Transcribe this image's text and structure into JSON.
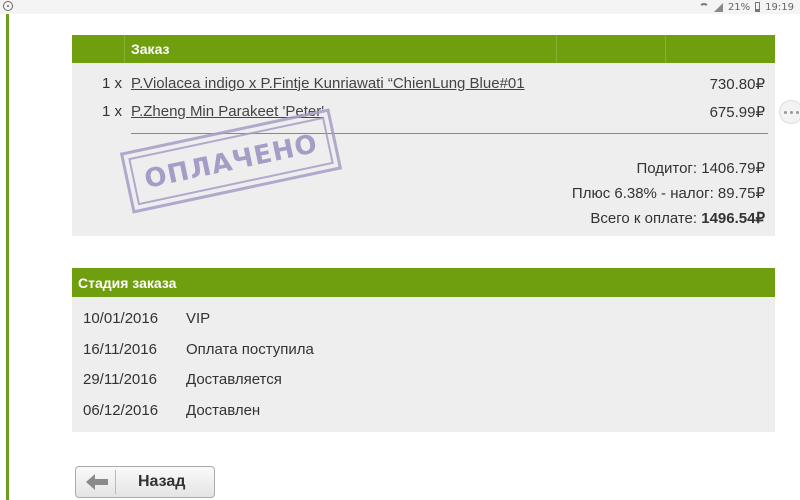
{
  "status_bar": {
    "battery": "21%",
    "time": "19:19"
  },
  "order": {
    "title": "Заказ",
    "items": [
      {
        "qty": "1 x",
        "name": "P.Violacea indigo x P.Fintje Kunriawati “ChienLung Blue#01",
        "price": "730.80₽"
      },
      {
        "qty": "1 x",
        "name": "P.Zheng Min Parakeet 'Peter'",
        "price": "675.99₽"
      }
    ],
    "subtotal": "Подитог: 1406.79₽",
    "tax": "Плюс 6.38% - налог: 89.75₽",
    "total_label": "Всего к оплате: ",
    "total_value": "1496.54₽",
    "stamp": "ОПЛАЧЕНО"
  },
  "stages": {
    "title": "Стадия заказа",
    "rows": [
      {
        "date": "10/01/2016",
        "status": "VIP"
      },
      {
        "date": "16/11/2016",
        "status": "Оплата поступила"
      },
      {
        "date": "29/11/2016",
        "status": "Доставляется"
      },
      {
        "date": "06/12/2016",
        "status": "Доставлен"
      }
    ]
  },
  "back_button": {
    "label": "Назад"
  },
  "colors": {
    "header_green": "#6f9e0f",
    "panel_bg": "#eeeeee",
    "stamp": "#a89cc6"
  }
}
